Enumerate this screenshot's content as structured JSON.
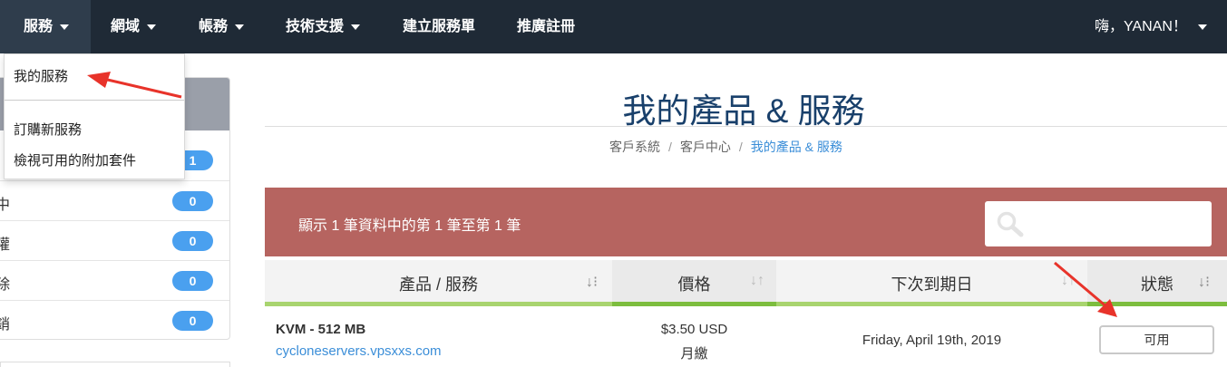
{
  "nav": {
    "services": "服務",
    "domains": "網域",
    "billing": "帳務",
    "support": "技術支援",
    "open_ticket": "建立服務單",
    "affiliates": "推廣註冊",
    "user_greeting": "嗨，YANAN！"
  },
  "dropdown": {
    "my_services": "我的服務",
    "order_new": "訂購新服務",
    "view_addons": "檢視可用的附加套件"
  },
  "sidebar": {
    "rows": [
      {
        "label": "",
        "count": "1"
      },
      {
        "label": "中",
        "count": "0"
      },
      {
        "label": "權",
        "count": "0"
      },
      {
        "label": "除",
        "count": "0"
      },
      {
        "label": "銷",
        "count": "0"
      }
    ]
  },
  "page": {
    "title": "我的產品 & 服務",
    "breadcrumb": [
      "客戶系統",
      "客戶中心",
      "我的產品 & 服務"
    ],
    "info": "顯示 1 筆資料中的第 1 筆至第 1 筆",
    "search_placeholder": ""
  },
  "table": {
    "headers": [
      "產品 / 服務",
      "價格",
      "下次到期日",
      "狀態"
    ],
    "rows": [
      {
        "product": "KVM - 512 MB",
        "domain": "cycloneservers.vpsxxs.com",
        "price": "$3.50 USD",
        "cycle": "月繳",
        "due_date": "Friday, April 19th, 2019",
        "status": "可用"
      }
    ]
  },
  "colors": {
    "nav_bg": "#1f2a36",
    "title": "#19406b",
    "info_bar": "#b66460",
    "badge": "#4aa0ef",
    "link": "#3b8ed8",
    "annotation_arrow": "#e8332a"
  }
}
